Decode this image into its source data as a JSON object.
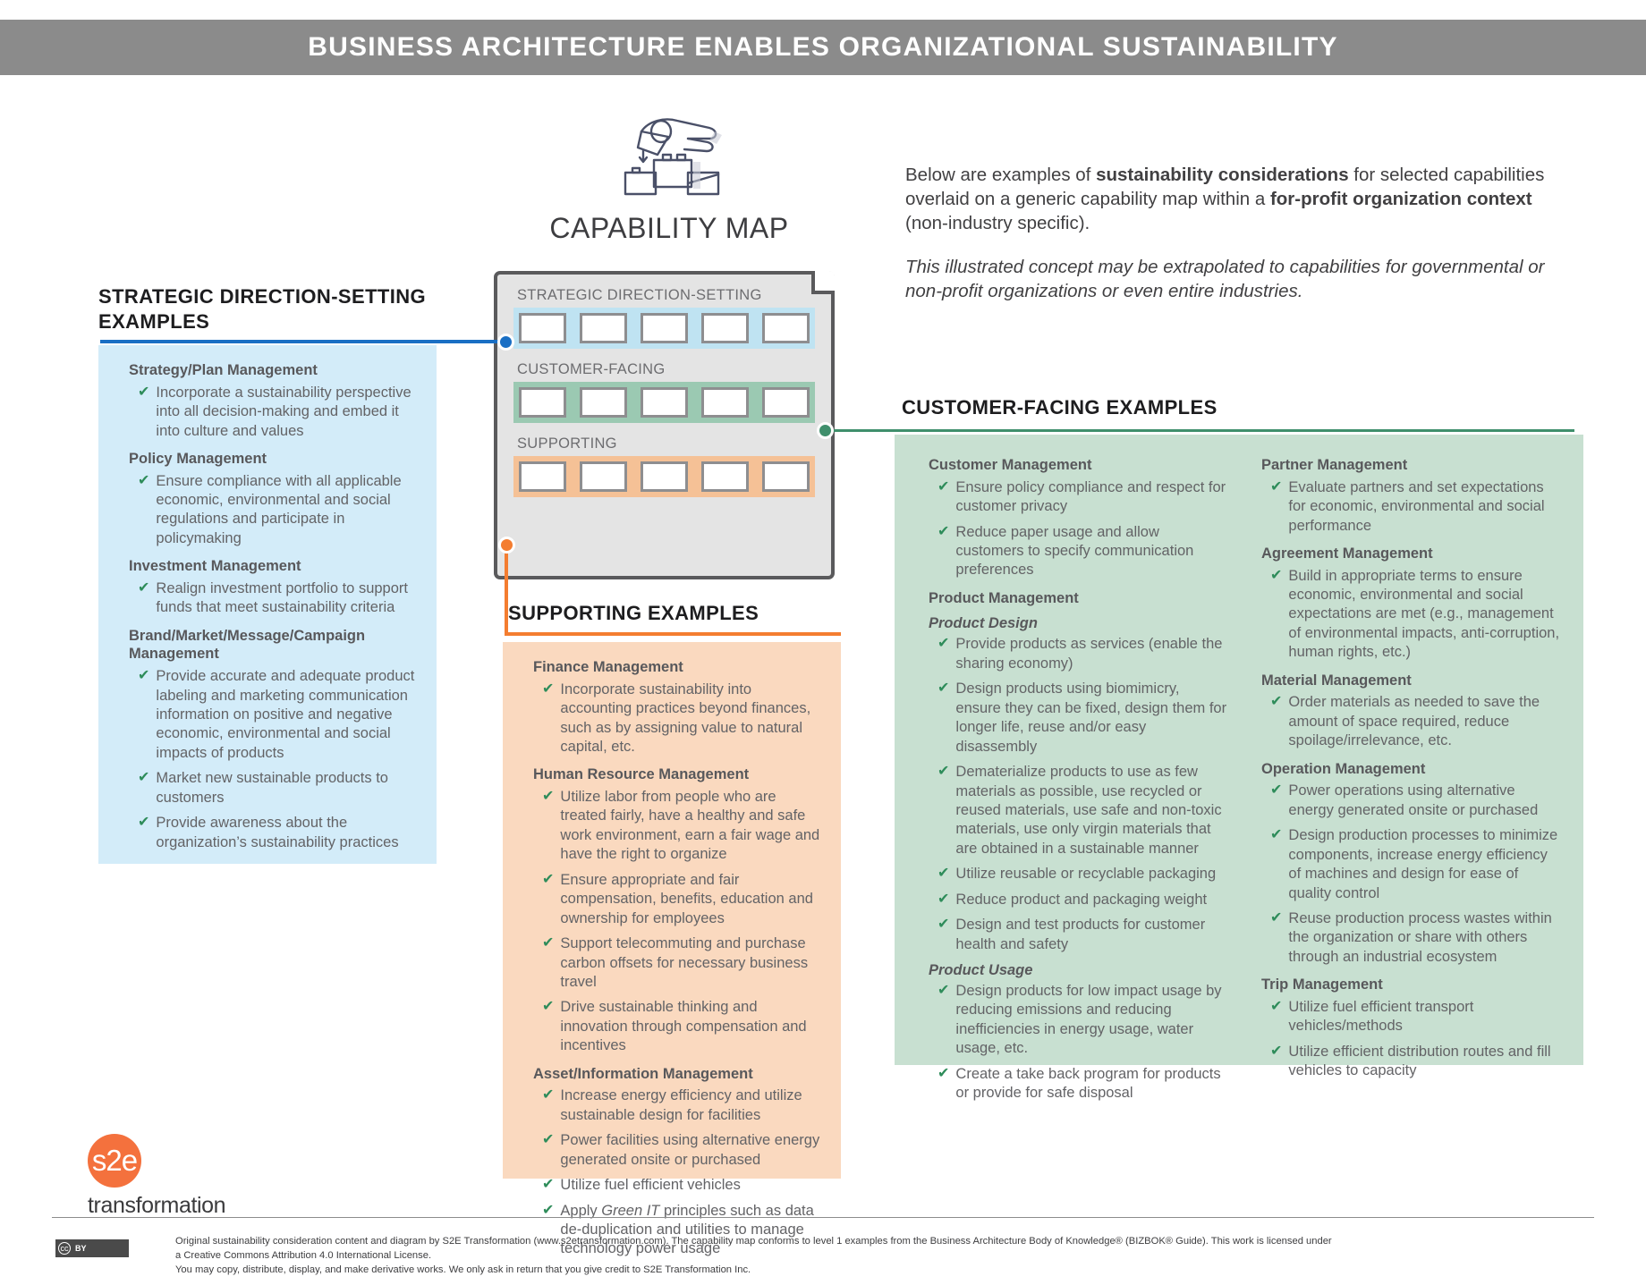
{
  "header": {
    "title": "BUSINESS ARCHITECTURE ENABLES ORGANIZATIONAL SUSTAINABILITY"
  },
  "colors": {
    "header_bar": "#8b8b8b",
    "strategic_accent": "#1a6fc4",
    "strategic_panel": "#d3ecf9",
    "customer_accent": "#3f8f6c",
    "customer_panel": "#c8e0d1",
    "supporting_accent": "#f47d30",
    "supporting_panel": "#fad9bf",
    "check_green": "#2e8c5a",
    "logo_orange": "#f4713d"
  },
  "capability_map": {
    "title": "CAPABILITY MAP",
    "icon": "hand-placing-block-icon",
    "rows": [
      {
        "label": "STRATEGIC DIRECTION-SETTING",
        "band_color": "#bfe3f2",
        "cells": 5
      },
      {
        "label": "CUSTOMER-FACING",
        "band_color": "#9bc9b2",
        "cells": 5
      },
      {
        "label": "SUPPORTING",
        "band_color": "#f5c196",
        "cells": 5
      }
    ]
  },
  "intro": {
    "paragraph1": {
      "part1": "Below are examples of ",
      "bold1": "sustainability considerations",
      "part2": " for selected capabilities overlaid on a generic capability map within a ",
      "bold2": "for-profit organization context",
      "part3": " (non-industry specific)."
    },
    "paragraph2": "This illustrated concept may be extrapolated to capabilities for governmental or non-profit organizations or even entire industries."
  },
  "strategic": {
    "heading": "STRATEGIC DIRECTION-SETTING EXAMPLES",
    "capabilities": [
      {
        "name": "Strategy/Plan Management",
        "bullets": [
          "Incorporate a sustainability perspective into all decision-making and embed it into culture and values"
        ]
      },
      {
        "name": "Policy Management",
        "bullets": [
          "Ensure compliance with all applicable economic, environmental and social regulations and participate in policymaking"
        ]
      },
      {
        "name": "Investment Management",
        "bullets": [
          "Realign investment portfolio to support funds that meet sustainability criteria"
        ]
      },
      {
        "name": "Brand/Market/Message/Campaign Management",
        "bullets": [
          "Provide accurate and adequate product labeling and marketing communication information on positive and negative economic, environmental and social impacts of products",
          "Market new sustainable products to customers",
          "Provide awareness about the organization’s sustainability practices"
        ]
      }
    ]
  },
  "supporting": {
    "heading": "SUPPORTING EXAMPLES",
    "capabilities": [
      {
        "name": "Finance Management",
        "bullets": [
          "Incorporate sustainability into accounting practices beyond finances, such as by assigning value to natural capital, etc."
        ]
      },
      {
        "name": "Human Resource Management",
        "bullets": [
          "Utilize labor from people who are treated fairly, have a healthy and safe work environment, earn a fair wage and have the right to organize",
          "Ensure appropriate and fair compensation, benefits, education and ownership for employees",
          "Support telecommuting and purchase carbon offsets for necessary business travel",
          "Drive sustainable thinking and innovation through compensation and incentives"
        ]
      },
      {
        "name": "Asset/Information Management",
        "bullets": [
          "Increase energy efficiency and utilize sustainable design for facilities",
          "Power facilities using alternative energy generated onsite or purchased",
          "Utilize fuel efficient vehicles"
        ]
      }
    ],
    "green_it_bullet": {
      "before": "Apply ",
      "italic": "Green IT",
      "after": " principles such as data de-duplication and utilities to manage technology power usage"
    }
  },
  "customer": {
    "heading": "CUSTOMER-FACING EXAMPLES",
    "column_left": [
      {
        "name": "Customer Management",
        "sub": null,
        "bullets": [
          "Ensure policy compliance and respect for customer privacy",
          "Reduce paper usage and allow customers to specify communication preferences"
        ]
      },
      {
        "name": "Product Management",
        "sub": "Product Design",
        "bullets": [
          "Provide products as services (enable the sharing economy)",
          "Design products using biomimicry, ensure they can be fixed, design them for longer life, reuse and/or easy disassembly",
          "Dematerialize products to use as few materials as possible, use recycled or reused materials, use safe and non-toxic materials, use only virgin materials that are obtained in a sustainable manner",
          "Utilize reusable or recyclable packaging",
          "Reduce product and packaging weight",
          "Design and test products for customer health and safety"
        ]
      },
      {
        "name": null,
        "sub": "Product Usage",
        "bullets": [
          "Design products for low impact usage by reducing emissions and reducing inefficiencies in energy usage, water usage, etc.",
          "Create a take back program for products or provide for safe disposal"
        ]
      }
    ],
    "column_right": [
      {
        "name": "Partner Management",
        "sub": null,
        "bullets": [
          "Evaluate partners and set expectations for economic, environmental and social performance"
        ]
      },
      {
        "name": "Agreement Management",
        "sub": null,
        "bullets": [
          "Build in appropriate terms to ensure economic, environmental and social expectations are met (e.g., management of environmental impacts, anti-corruption, human rights, etc.)"
        ]
      },
      {
        "name": "Material Management",
        "sub": null,
        "bullets": [
          "Order materials as needed to save the amount of space required, reduce spoilage/irrelevance, etc."
        ]
      },
      {
        "name": "Operation Management",
        "sub": null,
        "bullets": [
          "Power operations using alternative energy generated onsite or purchased",
          "Design production processes to minimize components, increase energy efficiency of machines and design for ease of quality control",
          "Reuse production process wastes within the organization or share with others through an industrial ecosystem"
        ]
      },
      {
        "name": "Trip Management",
        "sub": null,
        "bullets": [
          "Utilize fuel efficient transport vehicles/methods",
          "Utilize efficient distribution routes and fill vehicles to capacity"
        ]
      }
    ]
  },
  "logo": {
    "mark": "s2e",
    "word": "transformation"
  },
  "footer": {
    "cc_label": "BY",
    "line1": "Original sustainability consideration content and diagram by S2E Transformation (www.s2etransformation.com). The capability map conforms to level 1 examples from the Business Architecture Body of Knowledge® (BIZBOK® Guide). This work is licensed under a Creative Commons Attribution 4.0 International License.",
    "line2": "You may copy, distribute, display, and make derivative works. We only ask in return that you give credit to S2E Transformation Inc."
  }
}
